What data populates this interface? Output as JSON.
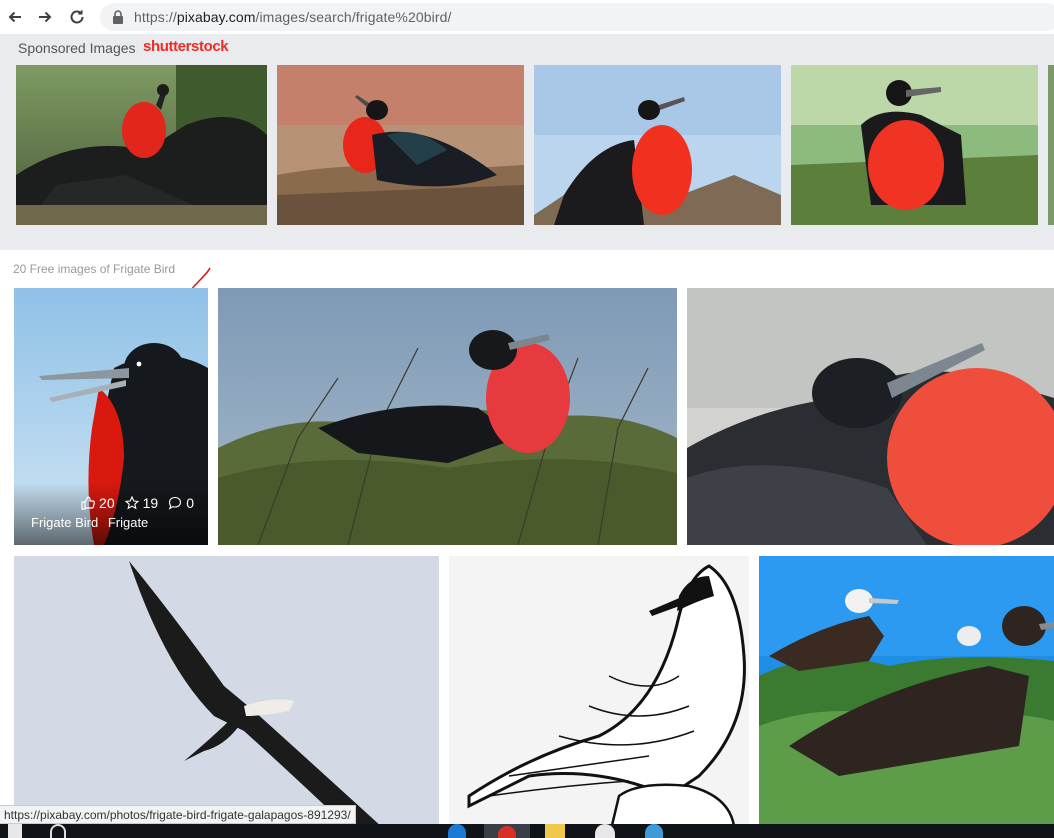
{
  "browser": {
    "url_prefix": "https://",
    "url_host": "pixabay.com",
    "url_path": "/images/search/frigate%20bird/"
  },
  "sponsored": {
    "label": "Sponsored Images",
    "brand": "shutterstock"
  },
  "results": {
    "heading": "20 Free images of Frigate Bird",
    "first_card": {
      "likes": "20",
      "favorites": "19",
      "comments": "0",
      "tags": [
        "Frigate Bird",
        "Frigate"
      ]
    }
  },
  "status_bar": {
    "link": "https://pixabay.com/photos/frigate-bird-frigate-galapagos-891293/"
  },
  "icons": {
    "back": "back-arrow-icon",
    "forward": "forward-arrow-icon",
    "reload": "reload-icon",
    "lock": "lock-icon",
    "like": "thumbs-up-icon",
    "favorite": "star-icon",
    "comment": "comment-icon"
  }
}
